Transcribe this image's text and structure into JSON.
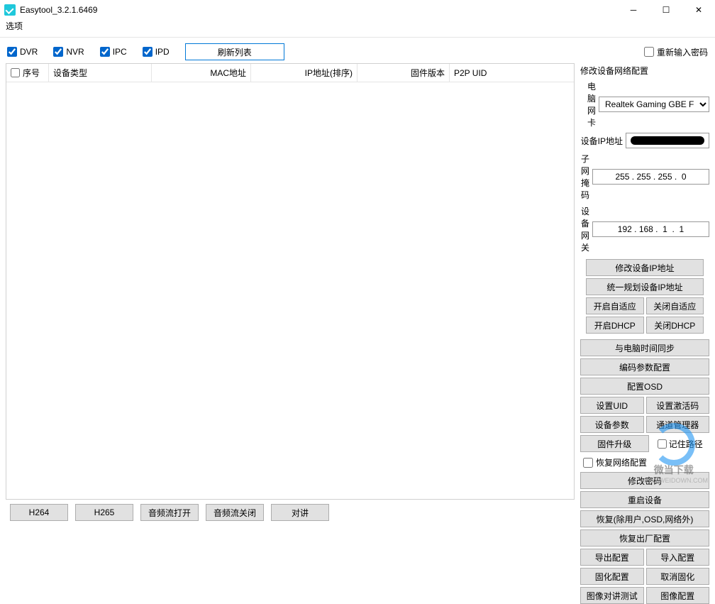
{
  "window": {
    "title": "Easytool_3.2.1.6469"
  },
  "menu": {
    "options": "选项"
  },
  "toolbar": {
    "dvr": "DVR",
    "nvr": "NVR",
    "ipc": "IPC",
    "ipd": "IPD",
    "refresh": "刷新列表",
    "reenter_password": "重新输入密码"
  },
  "table": {
    "headers": {
      "seq": "序号",
      "device_type": "设备类型",
      "mac": "MAC地址",
      "ip": "IP地址(排序)",
      "firmware": "固件版本",
      "p2p": "P2P UID"
    }
  },
  "panel": {
    "title": "修改设备网络配置",
    "nic_label": "电脑网卡",
    "nic_value": "Realtek Gaming GBE F",
    "ip_label": "设备IP地址",
    "subnet_label": "子网掩码",
    "subnet_value": "255 . 255 . 255 .  0",
    "gateway_label": "设备网关",
    "gateway_value": "192 . 168 .  1  .  1",
    "btn_modify_ip": "修改设备IP地址",
    "btn_plan_ip": "统一规划设备IP地址",
    "btn_enable_adaptive": "开启自适应",
    "btn_disable_adaptive": "关闭自适应",
    "btn_enable_dhcp": "开启DHCP",
    "btn_disable_dhcp": "关闭DHCP",
    "btn_time_sync": "与电脑时间同步",
    "btn_encode_config": "编码参数配置",
    "btn_osd_config": "配置OSD",
    "btn_set_uid": "设置UID",
    "btn_set_activation": "设置激活码",
    "btn_device_params": "设备参数",
    "btn_channel_mgr": "通道管理器",
    "btn_firmware_upgrade": "固件升级",
    "chk_remember_path": "记住路径",
    "chk_restore_network": "恢复网络配置",
    "btn_modify_password": "修改密码",
    "btn_restart_device": "重启设备",
    "btn_restore_except": "恢复(除用户,OSD,网络外)",
    "btn_restore_factory": "恢复出厂配置",
    "btn_export_config": "导出配置",
    "btn_import_config": "导入配置",
    "btn_solidify_config": "固化配置",
    "btn_cancel_solidify": "取消固化",
    "btn_image_intercom_test": "图像对讲测试",
    "btn_image_config": "图像配置"
  },
  "bottom": {
    "h264": "H264",
    "h265": "H265",
    "audio_open": "音频流打开",
    "audio_close": "音频流关闭",
    "intercom": "对讲"
  },
  "watermark": {
    "name": "微当下载",
    "url": "WWW.WEIDOWN.COM"
  }
}
